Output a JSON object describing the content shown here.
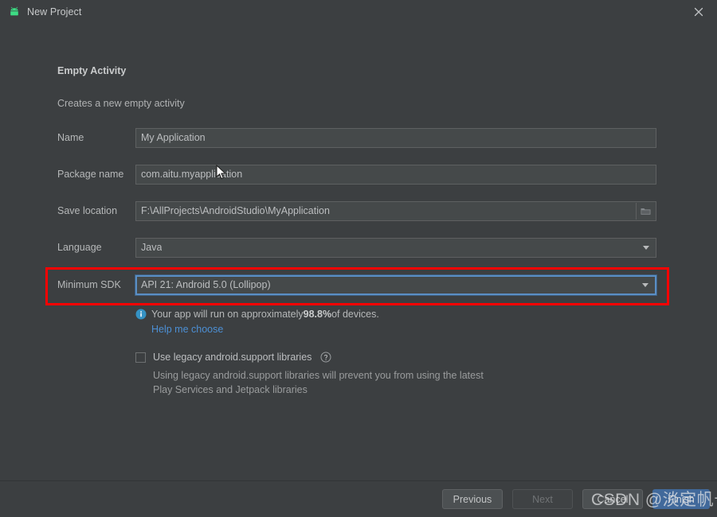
{
  "window": {
    "title": "New Project",
    "app_icon": "android-robot-icon",
    "close_icon": "close-icon"
  },
  "wizard": {
    "section_title": "Empty Activity",
    "section_subtitle": "Creates a new empty activity"
  },
  "fields": {
    "name": {
      "label": "Name",
      "value": "My Application"
    },
    "package_name": {
      "label": "Package name",
      "value": "com.aitu.myapplication"
    },
    "save_location": {
      "label": "Save location",
      "value": "F:\\AllProjects\\AndroidStudio\\MyApplication",
      "browse_icon": "folder-icon"
    },
    "language": {
      "label": "Language",
      "value": "Java",
      "arrow_icon": "chevron-down-icon"
    },
    "minimum_sdk": {
      "label": "Minimum SDK",
      "value": "API 21: Android 5.0 (Lollipop)",
      "arrow_icon": "chevron-down-icon",
      "focused": true,
      "highlight_color": "#fe0000"
    }
  },
  "sdk_info": {
    "icon": "info-icon",
    "text_before": "Your app will run on approximately ",
    "percentage": "98.8%",
    "text_after": " of devices.",
    "help_link": "Help me choose",
    "link_color": "#4c8fd4"
  },
  "legacy_option": {
    "label": "Use legacy android.support libraries",
    "checked": false,
    "help_icon": "question-mark-icon",
    "description": "Using legacy android.support libraries will prevent you from using the latest Play Services and Jetpack libraries"
  },
  "footer": {
    "previous": "Previous",
    "next": "Next",
    "cancel": "Cancel",
    "finish": "Finish"
  },
  "watermark": {
    "text": "CSDN @淡定帆号"
  },
  "colors": {
    "background": "#3c3f41",
    "field_background": "#45494a",
    "focus_blue": "#5a8ec4",
    "primary_button": "#41699b",
    "annotation_red": "#fe0000"
  }
}
